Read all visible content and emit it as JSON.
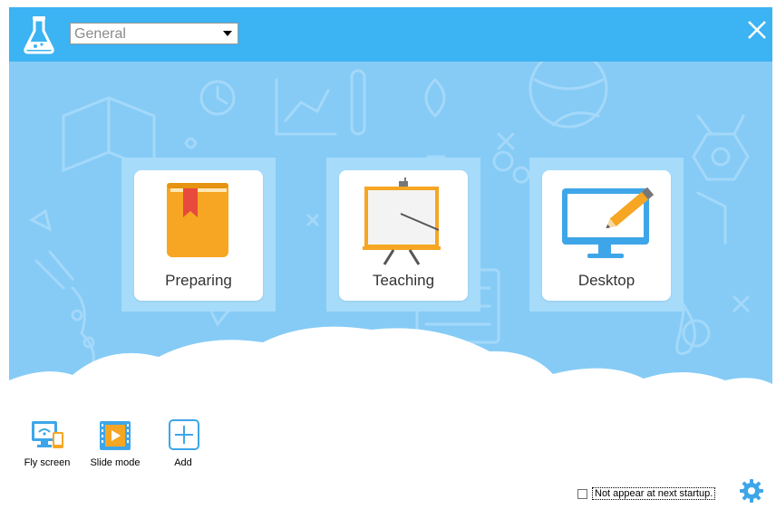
{
  "header": {
    "profile_select_value": "General",
    "colors": {
      "bar": "#3cb3f2",
      "hero": "#85cbf6"
    }
  },
  "cards": [
    {
      "label": "Preparing",
      "icon": "book-icon"
    },
    {
      "label": "Teaching",
      "icon": "easel-icon"
    },
    {
      "label": "Desktop",
      "icon": "monitor-pencil-icon"
    }
  ],
  "tools": [
    {
      "label": "Fly screen",
      "icon": "fly-screen-icon"
    },
    {
      "label": "Slide mode",
      "icon": "slide-mode-icon"
    },
    {
      "label": "Add",
      "icon": "add-icon"
    }
  ],
  "footer": {
    "startup_label": "Not appear at next startup.",
    "startup_checked": false
  }
}
